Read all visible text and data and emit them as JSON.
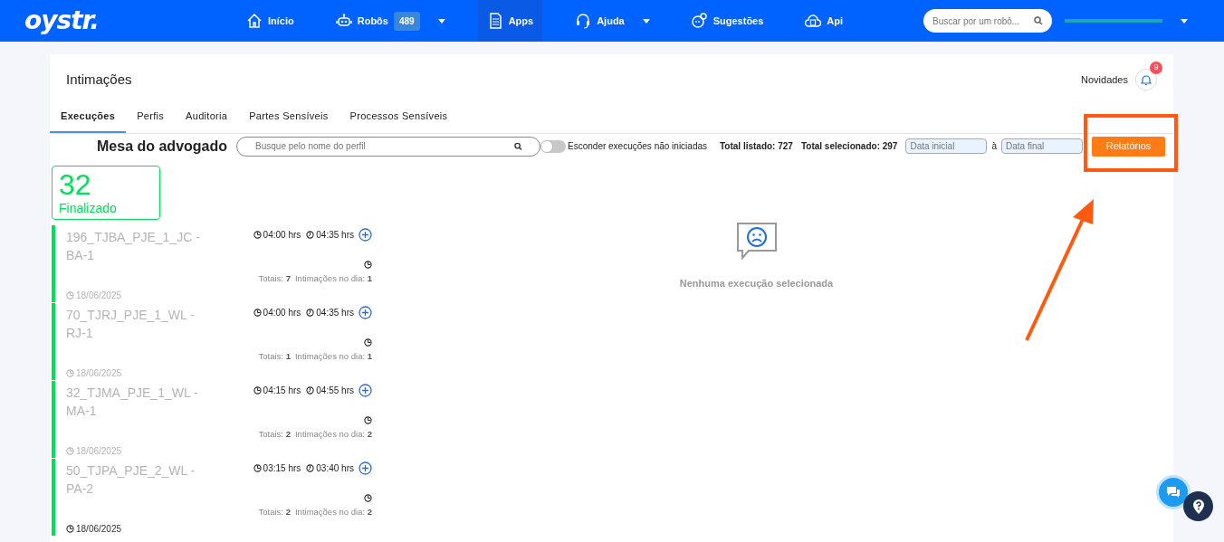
{
  "navbar": {
    "logo": "oystr.",
    "items": [
      {
        "label": "Início",
        "selected": false,
        "dropdown": false
      },
      {
        "label": "Robôs",
        "badge": "489",
        "selected": false,
        "dropdown": true
      },
      {
        "label": "Apps",
        "selected": true,
        "dropdown": false
      },
      {
        "label": "Ajuda",
        "selected": false,
        "dropdown": true
      },
      {
        "label": "Sugestões",
        "selected": false,
        "dropdown": false
      },
      {
        "label": "Api",
        "selected": false,
        "dropdown": false
      }
    ],
    "search": {
      "placeholder": "Buscar por um robô..."
    }
  },
  "page": {
    "title": "Intimações",
    "news_label": "Novidades",
    "notification_count": "9"
  },
  "tabs": [
    {
      "label": "Execuções",
      "selected": true
    },
    {
      "label": "Perfis",
      "selected": false
    },
    {
      "label": "Auditoria",
      "selected": false
    },
    {
      "label": "Partes Sensíveis",
      "selected": false
    },
    {
      "label": "Processos Sensíveis",
      "selected": false
    }
  ],
  "toolbar": {
    "heading": "Mesa do advogado",
    "search_placeholder": "Busque pelo nome do perfil",
    "toggle": {
      "label": "Esconder execuções não iniciadas",
      "on": false
    },
    "total_listed": "Total listado: 727",
    "total_selected": "Total selecionado: 297",
    "start_placeholder": "Data inicial",
    "separator": "à",
    "end_placeholder": "Data final",
    "report_button": "Relatórios"
  },
  "stat": {
    "value": "32",
    "label": "Finalizado"
  },
  "executions": [
    {
      "name": "196_TJBA_PJE_1_JC - BA-1",
      "start": "04:00 hrs",
      "end": "04:35 hrs",
      "totals_label": "Totais:",
      "totals": "7",
      "day_label": "Intimações no dia:",
      "day": "1",
      "date": "18/06/2025",
      "date_dimmed": true
    },
    {
      "name": "70_TJRJ_PJE_1_WL - RJ-1",
      "start": "04:00 hrs",
      "end": "04:35 hrs",
      "totals_label": "Totais:",
      "totals": "1",
      "day_label": "Intimações no dia:",
      "day": "1",
      "date": "18/06/2025",
      "date_dimmed": true
    },
    {
      "name": "32_TJMA_PJE_1_WL - MA-1",
      "start": "04:15 hrs",
      "end": "04:55 hrs",
      "totals_label": "Totais:",
      "totals": "2",
      "day_label": "Intimações no dia:",
      "day": "2",
      "date": "18/06/2025",
      "date_dimmed": true
    },
    {
      "name": "50_TJPA_PJE_2_WL - PA-2",
      "start": "03:15 hrs",
      "end": "03:40 hrs",
      "totals_label": "Totais:",
      "totals": "2",
      "day_label": "Intimações no dia:",
      "day": "2",
      "date": "18/06/2025",
      "date_dimmed": false
    }
  ],
  "empty_state": {
    "message": "Nenhuma execução selecionada"
  }
}
